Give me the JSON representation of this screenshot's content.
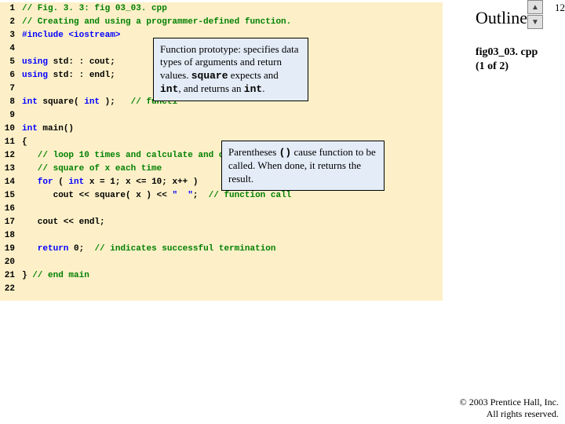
{
  "pageNumber": "12",
  "outlineLabel": "Outline",
  "figTitle": "fig03_03. cpp\n(1 of 2)",
  "copyright": "© 2003 Prentice Hall, Inc.\nAll rights reserved.",
  "lineNumbers": [
    "1",
    "2",
    "3",
    "4",
    "5",
    "6",
    "7",
    "8",
    "9",
    "10",
    "11",
    "12",
    "13",
    "14",
    "15",
    "16",
    "17",
    "18",
    "19",
    "20",
    "21",
    "22"
  ],
  "code": {
    "l1": {
      "c": "// Fig. 3. 3: fig 03_03. cpp"
    },
    "l2": {
      "c": "// Creating and using a programmer-defined function."
    },
    "l3a": "#include ",
    "l3b": "<iostream>",
    "l5a": "using ",
    "l5b": "std: : cout;",
    "l6a": "using ",
    "l6b": "std: : endl;",
    "l8a": "int",
    "l8b": " square( ",
    "l8c": "int",
    "l8d": " );   ",
    "l8e": "// functi",
    "l10a": "int",
    "l10b": " main()",
    "l11": "{",
    "l12": "   // loop 10 times and calculate and ou",
    "l13": "   // square of x each time",
    "l14a": "   for",
    "l14b": " ( ",
    "l14c": "int",
    "l14d": " x = ",
    "l14e": "1",
    "l14f": "; x <= ",
    "l14g": "10",
    "l14h": "; x++ )",
    "l15a": "      cout << square( x ) << ",
    "l15b": "\"  \"",
    "l15c": ";  ",
    "l15d": "// function call",
    "l17": "   cout << endl;",
    "l19a": "   return",
    "l19b": " ",
    "l19c": "0",
    "l19d": ";  ",
    "l19e": "// indicates successful termination",
    "l21a": "} ",
    "l21b": "// end main"
  },
  "callout1": {
    "t1": "Function prototype: specifies data types of arguments and return values. ",
    "s1": "square",
    "t2": " expects and ",
    "s2": "int",
    "t3": ", and returns an ",
    "s3": "int",
    "t4": "."
  },
  "callout2": {
    "t1": "Parentheses ",
    "s1": "()",
    "t2": " cause function to be called. When done, it returns the result."
  }
}
